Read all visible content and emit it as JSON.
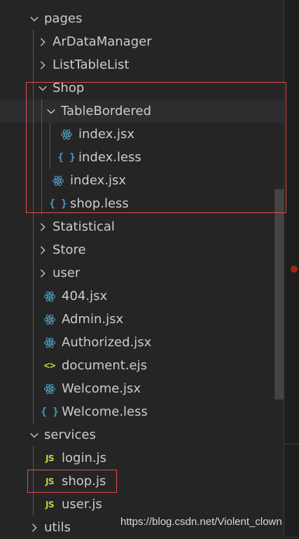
{
  "explorer": {
    "items": [
      {
        "label": "pages",
        "kind": "folder",
        "expanded": true,
        "depth": 0,
        "icon": "chevron-down-icon"
      },
      {
        "label": "ArDataManager",
        "kind": "folder",
        "expanded": false,
        "depth": 1,
        "icon": "chevron-right-icon"
      },
      {
        "label": "ListTableList",
        "kind": "folder",
        "expanded": false,
        "depth": 1,
        "icon": "chevron-right-icon"
      },
      {
        "label": "Shop",
        "kind": "folder",
        "expanded": true,
        "depth": 1,
        "icon": "chevron-down-icon"
      },
      {
        "label": "TableBordered",
        "kind": "folder",
        "expanded": true,
        "depth": 2,
        "icon": "chevron-down-icon",
        "selected": true
      },
      {
        "label": "index.jsx",
        "kind": "react",
        "depth": 3,
        "icon": "react-icon"
      },
      {
        "label": "index.less",
        "kind": "less",
        "depth": 3,
        "icon": "less-braces-icon",
        "icon_text": "{ }"
      },
      {
        "label": "index.jsx",
        "kind": "react",
        "depth": 2,
        "icon": "react-icon"
      },
      {
        "label": "shop.less",
        "kind": "less",
        "depth": 2,
        "icon": "less-braces-icon",
        "icon_text": "{ }"
      },
      {
        "label": "Statistical",
        "kind": "folder",
        "expanded": false,
        "depth": 1,
        "icon": "chevron-right-icon"
      },
      {
        "label": "Store",
        "kind": "folder",
        "expanded": false,
        "depth": 1,
        "icon": "chevron-right-icon"
      },
      {
        "label": "user",
        "kind": "folder",
        "expanded": false,
        "depth": 1,
        "icon": "chevron-right-icon"
      },
      {
        "label": "404.jsx",
        "kind": "react",
        "depth": 1,
        "icon": "react-icon"
      },
      {
        "label": "Admin.jsx",
        "kind": "react",
        "depth": 1,
        "icon": "react-icon"
      },
      {
        "label": "Authorized.jsx",
        "kind": "react",
        "depth": 1,
        "icon": "react-icon"
      },
      {
        "label": "document.ejs",
        "kind": "ejs",
        "depth": 1,
        "icon": "ejs-brackets-icon",
        "icon_text": "<>"
      },
      {
        "label": "Welcome.jsx",
        "kind": "react",
        "depth": 1,
        "icon": "react-icon"
      },
      {
        "label": "Welcome.less",
        "kind": "less",
        "depth": 1,
        "icon": "less-braces-icon",
        "icon_text": "{ }"
      },
      {
        "label": "services",
        "kind": "folder",
        "expanded": true,
        "depth": 0,
        "icon": "chevron-down-icon"
      },
      {
        "label": "login.js",
        "kind": "js",
        "depth": 1,
        "icon": "js-icon",
        "icon_text": "JS"
      },
      {
        "label": "shop.js",
        "kind": "js",
        "depth": 1,
        "icon": "js-icon",
        "icon_text": "JS"
      },
      {
        "label": "user.js",
        "kind": "js",
        "depth": 1,
        "icon": "js-icon",
        "icon_text": "JS"
      },
      {
        "label": "utils",
        "kind": "folder",
        "expanded": false,
        "depth": 0,
        "icon": "chevron-right-icon"
      }
    ]
  },
  "colors": {
    "background": "#252526",
    "text": "#cccccc",
    "react": "#519aba",
    "less": "#519aba",
    "js": "#cbcb41",
    "ejs": "#cbcb41",
    "highlight_box": "#e04b4b"
  },
  "watermark": "https://blog.csdn.net/Violent_clown"
}
